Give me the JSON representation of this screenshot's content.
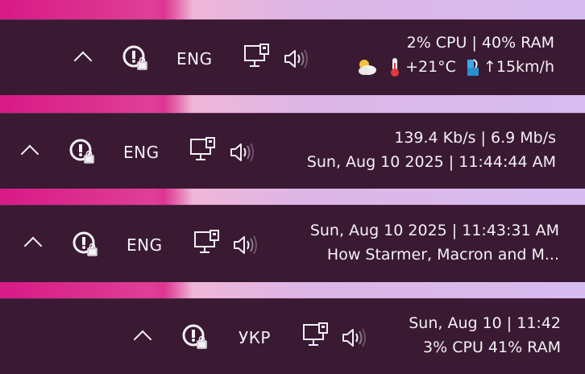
{
  "bars": [
    {
      "language": "ENG",
      "line1": "2% CPU | 40% RAM",
      "weather": {
        "temperature": "+21°C",
        "wind": "↑15km/h"
      }
    },
    {
      "language": "ENG",
      "line1": "139.4 Kb/s | 6.9 Mb/s",
      "line2": "Sun, Aug 10 2025 | 11:44:44 AM"
    },
    {
      "language": "ENG",
      "line1": "Sun, Aug 10 2025 | 11:43:31 AM",
      "line2": "How Starmer, Macron and M..."
    },
    {
      "language": "УКР",
      "line1": "Sun, Aug 10 | 11:42",
      "line2": "3% CPU 41% RAM"
    }
  ],
  "icons": {
    "overflow": "chevron-up-icon",
    "security": "security-lock-icon",
    "network": "ethernet-monitor-icon",
    "volume": "speaker-icon",
    "weather": "partly-cloudy-icon",
    "temperature": "thermometer-icon",
    "wind": "wind-icon"
  },
  "colors": {
    "taskbar_bg": "#3a1933",
    "text": "#f4f1f4",
    "wallpaper_pink": "#d81a86",
    "wallpaper_lavender": "#d7bcf0"
  }
}
